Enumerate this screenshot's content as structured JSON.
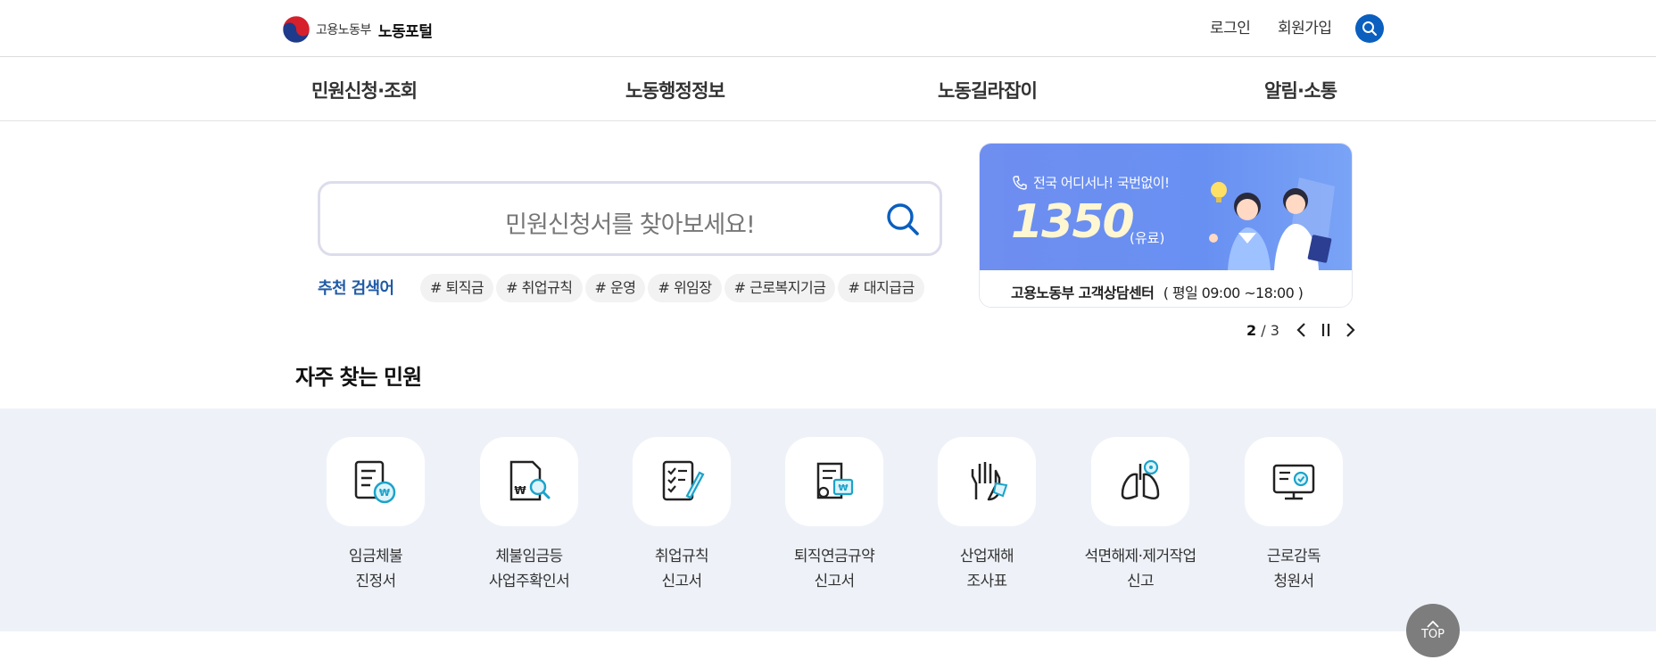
{
  "header": {
    "ministry": "고용노동부",
    "portal": "노동포털",
    "login": "로그인",
    "join": "회원가입"
  },
  "gnb": [
    "민원신청·조회",
    "노동행정정보",
    "노동길라잡이",
    "알림·소통"
  ],
  "search": {
    "placeholder": "민원신청서를 찾아보세요!",
    "recommend_label": "추천 검색어",
    "tags": [
      "# 퇴직금",
      "# 취업규칙",
      "# 운영",
      "# 위임장",
      "# 근로복지기금",
      "# 대지급금"
    ]
  },
  "banner": {
    "line": "전국 어디서나! 국번없이!",
    "number": "1350",
    "paid": "(유료)",
    "caption_strong": "고용노동부 고객상담센터",
    "caption_hours": "( 평일 09:00 ~18:00 )",
    "current": "2",
    "total": "3"
  },
  "frequent": {
    "title": "자주 찾는 민원",
    "items": [
      {
        "label": "임금체불\n진정서",
        "icon": "wage-document-icon"
      },
      {
        "label": "체불임금등\n사업주확인서",
        "icon": "document-search-icon"
      },
      {
        "label": "취업규칙\n신고서",
        "icon": "checklist-pen-icon"
      },
      {
        "label": "퇴직연금규약\n신고서",
        "icon": "pension-document-icon"
      },
      {
        "label": "산업재해\n조사표",
        "icon": "injured-hand-icon"
      },
      {
        "label": "석면해제·제거작업\n신고",
        "icon": "lungs-icon"
      },
      {
        "label": "근로감독\n청원서",
        "icon": "monitor-check-icon"
      }
    ]
  },
  "top_button": "TOP",
  "colors": {
    "accent": "#0a5fbf",
    "recommend": "#1f5aa6",
    "banner": "#6890f2",
    "section_bg": "#eef2f8"
  }
}
